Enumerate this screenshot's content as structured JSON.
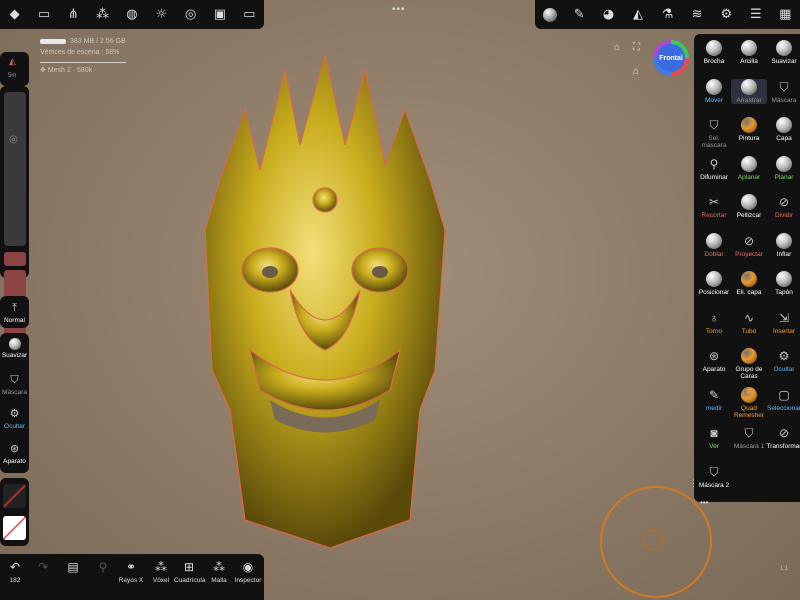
{
  "stats": {
    "memory": "383 MB / 2.56 GB",
    "vertices": "Vértices de escena : 58%",
    "mesh": "Mesh 2 · 580k ·"
  },
  "left": {
    "mini_label": "5m",
    "normal": "Normal",
    "suavizar": "Suavizar",
    "mascara": "Máscara",
    "ocultar": "Ocultar",
    "aparato": "Aparato"
  },
  "bottom": {
    "count": "182",
    "rayos": "Rayos X",
    "voxel": "Vóxel",
    "cuadricula": "Cuadrícula",
    "malla": "Malla",
    "inspector": "Inspector"
  },
  "gizmo": {
    "label": "Frontal"
  },
  "tools": [
    {
      "label": "Brocha"
    },
    {
      "label": "Arcilla"
    },
    {
      "label": "Suavizar"
    },
    {
      "label": "Mover"
    },
    {
      "label": "Arrastrar"
    },
    {
      "label": "Máscara"
    },
    {
      "label": "Sel. máscara"
    },
    {
      "label": "Pintura"
    },
    {
      "label": "Capa"
    },
    {
      "label": "Difuminar"
    },
    {
      "label": "Aplanar"
    },
    {
      "label": "Planar"
    },
    {
      "label": "Recortar"
    },
    {
      "label": "Pellizcar"
    },
    {
      "label": "Dividir"
    },
    {
      "label": "Doblar"
    },
    {
      "label": "Proyectar"
    },
    {
      "label": "Inflar"
    },
    {
      "label": "Posicionar"
    },
    {
      "label": "Eli. capa"
    },
    {
      "label": "Tapón"
    },
    {
      "label": "Torno"
    },
    {
      "label": "Tubo"
    },
    {
      "label": "Insertar"
    },
    {
      "label": "Aparato"
    },
    {
      "label": "Grupo de Caras"
    },
    {
      "label": "Ocultar"
    },
    {
      "label": "medir"
    },
    {
      "label": "Quad Remesher"
    },
    {
      "label": "Seleccionar"
    },
    {
      "label": "Ver"
    },
    {
      "label": "Máscara 1"
    },
    {
      "label": "Transformar"
    },
    {
      "label": "Máscara 2"
    }
  ],
  "zoom": "1:1",
  "colors": {
    "panel": "#111111",
    "background": "#8c7a66",
    "accent_orange": "#f2a040",
    "mask_red": "#8d4444"
  }
}
